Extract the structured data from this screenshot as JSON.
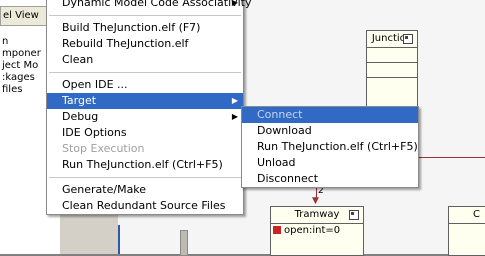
{
  "left_panel": {
    "tab_label": "el View",
    "tree_items": [
      "n",
      "mponer",
      "ject Mo",
      ":kages",
      "files"
    ]
  },
  "diagram": {
    "junction": {
      "title": "Junction"
    },
    "tramway": {
      "title": "Tramway",
      "attribute": "open:int=0"
    },
    "partial_class": {
      "title": "C"
    },
    "association_label": "2"
  },
  "context_menu": {
    "items": [
      {
        "label": "Dynamic Model Code Associativity",
        "has_submenu": true,
        "enabled": true
      },
      {
        "separator": true
      },
      {
        "label": "Build TheJunction.elf (F7)",
        "enabled": true
      },
      {
        "label": "Rebuild TheJunction.elf",
        "enabled": true
      },
      {
        "label": "Clean",
        "enabled": true
      },
      {
        "separator": true
      },
      {
        "label": "Open IDE ...",
        "enabled": true
      },
      {
        "label": "Target",
        "has_submenu": true,
        "enabled": true,
        "active": true
      },
      {
        "label": "Debug",
        "has_submenu": true,
        "enabled": true
      },
      {
        "label": "IDE Options",
        "enabled": true
      },
      {
        "label": "Stop Execution",
        "enabled": false
      },
      {
        "label": "Run TheJunction.elf (Ctrl+F5)",
        "enabled": true
      },
      {
        "separator": true
      },
      {
        "label": "Generate/Make",
        "enabled": true
      },
      {
        "label": "Clean Redundant Source Files",
        "enabled": true
      }
    ]
  },
  "target_submenu": {
    "items": [
      {
        "label": "Connect",
        "enabled": false,
        "active": true
      },
      {
        "label": "Download",
        "enabled": true
      },
      {
        "label": "Run TheJunction.elf (Ctrl+F5)",
        "enabled": true
      },
      {
        "label": "Unload",
        "enabled": true
      },
      {
        "label": "Disconnect",
        "enabled": true
      }
    ]
  },
  "colors": {
    "highlight": "#316ac5",
    "disabled_text": "#a0a0a0",
    "association_line": "#993333"
  }
}
